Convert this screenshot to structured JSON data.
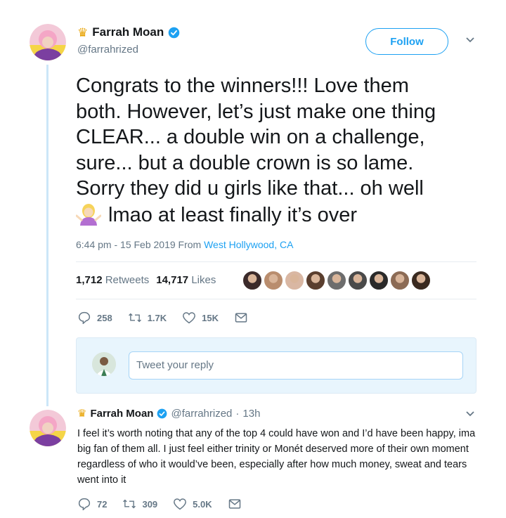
{
  "tweet": {
    "display_name": "Farrah Moan",
    "handle": "@farrahrized",
    "follow_label": "Follow",
    "text_lines": [
      "Congrats to the winners!!! Love them",
      "both. However, let’s just make one thing",
      "CLEAR... a double win on a challenge,",
      "sure... but a double crown is so lame.",
      "Sorry they did u girls like that... oh well",
      "lmao at least finally it’s over"
    ],
    "emoji_icon": "woman-shrugging-emoji",
    "timestamp": "6:44 pm - 15 Feb 2019 From",
    "location": "West Hollywood, CA",
    "retweets_count": "1,712",
    "retweets_label": "Retweets",
    "likes_count": "14,717",
    "likes_label": "Likes",
    "likers_colors": [
      "#3b2a2a",
      "#b98d6e",
      "#d9b7a3",
      "#5a3e2e",
      "#6d6d6d",
      "#4a4a4a",
      "#2a2a2a",
      "#8c6b55",
      "#3a2a20"
    ],
    "actions": {
      "replies": "258",
      "retweets": "1.7K",
      "likes": "15K"
    }
  },
  "reply_box": {
    "placeholder": "Tweet your reply"
  },
  "reply_tweet": {
    "display_name": "Farrah Moan",
    "handle": "@farrahrized",
    "separator": "·",
    "time": "13h",
    "text": "I feel it’s worth noting that any of the top 4 could have won and I’d have been happy, ima big fan of them all. I just feel either trinity or Monét deserved more of their own moment regardless of who it would’ve been, especially after how much money, sweat and tears went into it",
    "actions": {
      "replies": "72",
      "retweets": "309",
      "likes": "5.0K"
    }
  },
  "colors": {
    "accent": "#1da1f2",
    "text": "#14171a",
    "muted": "#657786",
    "thread_line": "#cce6f8"
  }
}
